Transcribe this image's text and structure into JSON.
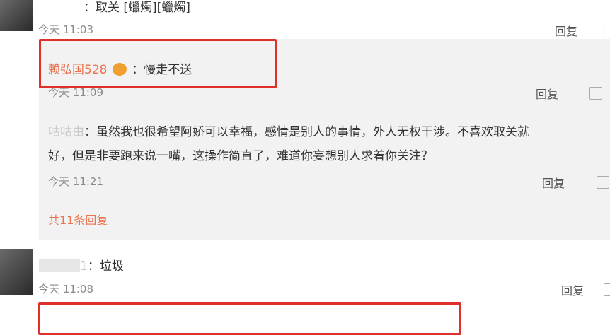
{
  "comment1": {
    "text": "：取关 [蠟燭][蠟燭]",
    "time": "今天 11:03",
    "reply_label": "回复"
  },
  "replies": [
    {
      "username": "赖弘国528",
      "text": "：慢走不送",
      "time": "今天 11:09",
      "reply_label": "回复"
    },
    {
      "username": "咕咕由",
      "text_line1": "：虽然我也很希望阿娇可以幸福，感情是别人的事情，外人无权干涉。不喜欢取关就",
      "text_line2": "好，但是非要跑来说一嘴，这操作简直了，难道你妄想别人求着你关注？",
      "time": "今天 11:21",
      "reply_label": "回复"
    }
  ],
  "more_replies": "共11条回复",
  "comment2": {
    "username_suffix": "1",
    "text": "：垃圾",
    "time": "今天 11:08",
    "reply_label": "回复"
  },
  "colors": {
    "accent": "#eb7350",
    "highlight": "#e0302b",
    "reply_bg": "#f2f2f2"
  }
}
